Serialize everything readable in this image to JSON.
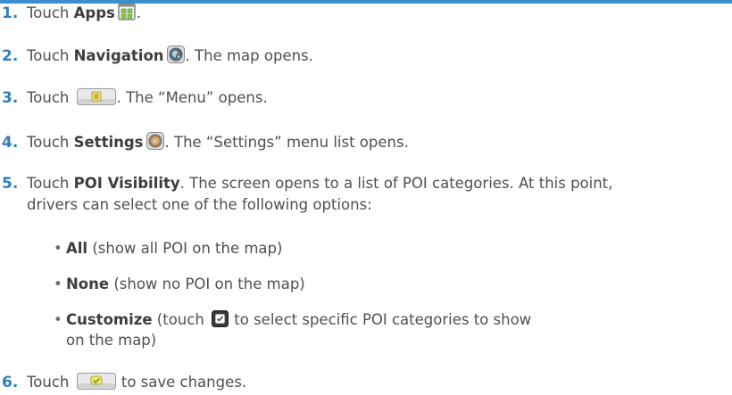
{
  "steps": [
    {
      "num": "1.",
      "pre": "Touch ",
      "label": "Apps",
      "icon": "apps-icon",
      "post": "."
    },
    {
      "num": "2.",
      "pre": "Touch ",
      "label": "Navigation",
      "icon": "navigation-globe-icon",
      "post": ". The map opens."
    },
    {
      "num": "3.",
      "pre": "Touch ",
      "label": "",
      "icon": "menu-button-icon",
      "post": ". The “Menu” opens."
    },
    {
      "num": "4.",
      "pre": "Touch ",
      "label": "Settings",
      "icon": "settings-gear-icon",
      "post": ". The “Settings” menu list opens."
    },
    {
      "num": "5.",
      "pre": "Touch ",
      "label": "POI Visibility",
      "post": ". The screen opens to a list of POI categories. At this point,",
      "post2": "drivers can select one of the following options:"
    },
    {
      "num": "6.",
      "pre": "Touch ",
      "label": "",
      "icon": "save-check-icon",
      "post": " to save changes."
    }
  ],
  "options": [
    {
      "label": "All",
      "post": " (show all POI on the map)"
    },
    {
      "label": "None",
      "post": " (show no POI on the map)"
    },
    {
      "label": "Customize",
      "pre_icon": " (touch ",
      "icon": "customize-checkbox-icon",
      "post": " to select specific POI categories to show",
      "post2": "on the map)"
    }
  ]
}
